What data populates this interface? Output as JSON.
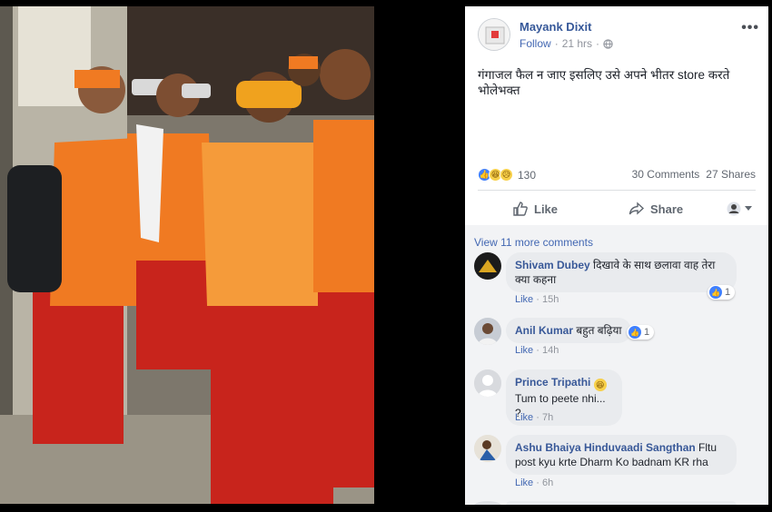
{
  "post": {
    "author": "Mayank Dixit",
    "follow_label": "Follow",
    "time": "21 hrs",
    "dot": "·",
    "text": "गंगाजल फैल न जाए इसलिए उसे अपने भीतर store करते भोलेभक्त",
    "reaction_count": "130",
    "comments_count": "30 Comments",
    "shares_count": "27 Shares",
    "like_label": "Like",
    "share_label": "Share"
  },
  "comments": {
    "view_more": "View 11 more comments",
    "items": [
      {
        "name": "Shivam Dubey",
        "text": "दिखावे के साथ छलावा वाह तेरा क्या कहना",
        "like": "Like",
        "dot": "·",
        "time": "15h",
        "reactions": "1"
      },
      {
        "name": "Anil Kumar",
        "text": "बहुत बढ़िया",
        "like": "Like",
        "dot": "·",
        "time": "14h",
        "reactions": "1"
      },
      {
        "name": "Prince Tripathi",
        "text": "Tum to peete nhi... ?",
        "like": "Like",
        "dot": "·",
        "time": "7h"
      },
      {
        "name": "Ashu Bhaiya Hinduvaadi Sangthan",
        "text": "Fltu post kyu krte Dharm Ko badnam KR rha",
        "like": "Like",
        "dot": "·",
        "time": "6h"
      }
    ]
  },
  "colors": {
    "link": "#4267b2",
    "name": "#365899",
    "saffron": "#f07a22",
    "red": "#c8241c"
  }
}
